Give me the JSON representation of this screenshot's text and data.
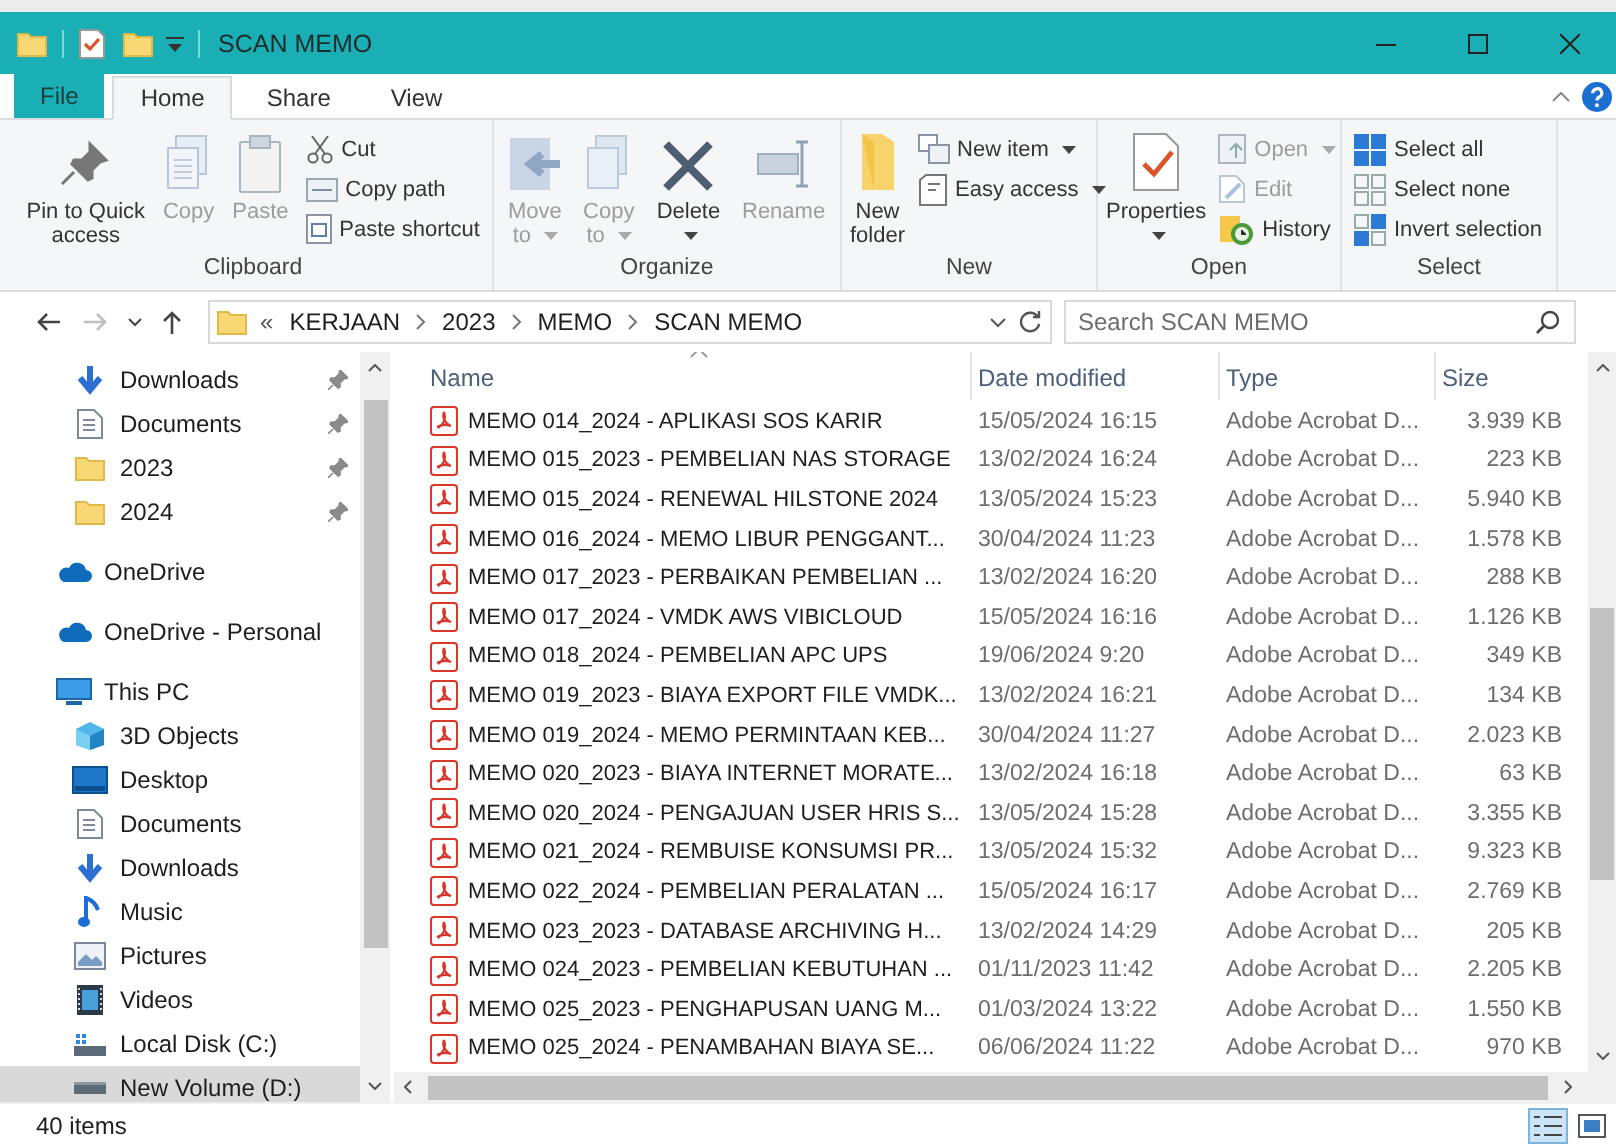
{
  "window": {
    "title": "SCAN MEMO"
  },
  "ribbon_tabs": [
    {
      "label": "File",
      "kind": "file",
      "selected": false
    },
    {
      "label": "Home",
      "kind": "tab",
      "selected": true
    },
    {
      "label": "Share",
      "kind": "tab",
      "selected": false
    },
    {
      "label": "View",
      "kind": "tab",
      "selected": false
    }
  ],
  "ribbon_groups": [
    {
      "label": "Clipboard",
      "commands": [
        {
          "label": "Pin to Quick access",
          "kind": "large",
          "disabled": false,
          "dropdown": false
        },
        {
          "label": "Copy",
          "kind": "large",
          "disabled": true,
          "dropdown": false
        },
        {
          "label": "Paste",
          "kind": "large",
          "disabled": true,
          "dropdown": false
        },
        {
          "label": "Cut",
          "kind": "small",
          "disabled": false,
          "dropdown": false
        },
        {
          "label": "Copy path",
          "kind": "small",
          "disabled": false,
          "dropdown": false
        },
        {
          "label": "Paste shortcut",
          "kind": "small",
          "disabled": false,
          "dropdown": false
        }
      ]
    },
    {
      "label": "Organize",
      "commands": [
        {
          "label": "Move to",
          "kind": "large",
          "disabled": true,
          "dropdown": true
        },
        {
          "label": "Copy to",
          "kind": "large",
          "disabled": true,
          "dropdown": true
        },
        {
          "label": "Delete",
          "kind": "large",
          "disabled": false,
          "dropdown": true
        },
        {
          "label": "Rename",
          "kind": "large",
          "disabled": true,
          "dropdown": false
        }
      ]
    },
    {
      "label": "New",
      "commands": [
        {
          "label": "New folder",
          "kind": "large",
          "disabled": false,
          "dropdown": false
        },
        {
          "label": "New item",
          "kind": "small",
          "disabled": false,
          "dropdown": true
        },
        {
          "label": "Easy access",
          "kind": "small",
          "disabled": false,
          "dropdown": true
        }
      ]
    },
    {
      "label": "Open",
      "commands": [
        {
          "label": "Properties",
          "kind": "large",
          "disabled": false,
          "dropdown": true
        },
        {
          "label": "Open",
          "kind": "small",
          "disabled": true,
          "dropdown": true
        },
        {
          "label": "Edit",
          "kind": "small",
          "disabled": true,
          "dropdown": false
        },
        {
          "label": "History",
          "kind": "small",
          "disabled": false,
          "dropdown": false
        }
      ]
    },
    {
      "label": "Select",
      "commands": [
        {
          "label": "Select all",
          "kind": "small",
          "disabled": false,
          "dropdown": false
        },
        {
          "label": "Select none",
          "kind": "small",
          "disabled": false,
          "dropdown": false
        },
        {
          "label": "Invert selection",
          "kind": "small",
          "disabled": false,
          "dropdown": false
        }
      ]
    }
  ],
  "address_bar": {
    "nav_buttons": [
      {
        "disabled": false
      },
      {
        "disabled": true
      },
      {
        "disabled": false
      },
      {
        "disabled": false
      }
    ],
    "overflow": "«",
    "path": [
      "KERJAAN",
      "2023",
      "MEMO",
      "SCAN MEMO"
    ],
    "search": {
      "placeholder": "Search SCAN MEMO"
    }
  },
  "nav_pane": {
    "quick_access": [
      {
        "label": "Downloads",
        "pinned": true
      },
      {
        "label": "Documents",
        "pinned": true
      },
      {
        "label": "2023",
        "pinned": true
      },
      {
        "label": "2024",
        "pinned": true
      }
    ],
    "locations": [
      {
        "label": "OneDrive",
        "selected": false
      },
      {
        "label": "OneDrive - Personal",
        "selected": false
      }
    ],
    "this_pc": {
      "label": "This PC",
      "selected": false,
      "children": [
        {
          "label": "3D Objects",
          "selected": false
        },
        {
          "label": "Desktop",
          "selected": false
        },
        {
          "label": "Documents",
          "selected": false
        },
        {
          "label": "Downloads",
          "selected": false
        },
        {
          "label": "Music",
          "selected": false
        },
        {
          "label": "Pictures",
          "selected": false
        },
        {
          "label": "Videos",
          "selected": false
        },
        {
          "label": "Local Disk (C:)",
          "selected": false
        },
        {
          "label": "New Volume (D:)",
          "selected": true
        }
      ]
    }
  },
  "file_list": {
    "columns": [
      {
        "label": "Name",
        "sorted": true
      },
      {
        "label": "Date modified",
        "sorted": false
      },
      {
        "label": "Type",
        "sorted": false
      },
      {
        "label": "Size",
        "sorted": false
      }
    ],
    "rows": [
      {
        "name": "MEMO 014_2024 - APLIKASI SOS KARIR",
        "date": "15/05/2024 16:15",
        "type": "Adobe Acrobat D...",
        "size": "3.939 KB"
      },
      {
        "name": "MEMO 015_2023 - PEMBELIAN NAS STORAGE",
        "date": "13/02/2024 16:24",
        "type": "Adobe Acrobat D...",
        "size": "223 KB"
      },
      {
        "name": "MEMO 015_2024 - RENEWAL HILSTONE 2024",
        "date": "13/05/2024 15:23",
        "type": "Adobe Acrobat D...",
        "size": "5.940 KB"
      },
      {
        "name": "MEMO 016_2024 - MEMO LIBUR PENGGANT...",
        "date": "30/04/2024 11:23",
        "type": "Adobe Acrobat D...",
        "size": "1.578 KB"
      },
      {
        "name": "MEMO 017_2023 - PERBAIKAN PEMBELIAN ...",
        "date": "13/02/2024 16:20",
        "type": "Adobe Acrobat D...",
        "size": "288 KB"
      },
      {
        "name": "MEMO 017_2024 - VMDK AWS VIBICLOUD",
        "date": "15/05/2024 16:16",
        "type": "Adobe Acrobat D...",
        "size": "1.126 KB"
      },
      {
        "name": "MEMO 018_2024 - PEMBELIAN APC UPS",
        "date": "19/06/2024 9:20",
        "type": "Adobe Acrobat D...",
        "size": "349 KB"
      },
      {
        "name": "MEMO 019_2023 - BIAYA EXPORT FILE VMDK...",
        "date": "13/02/2024 16:21",
        "type": "Adobe Acrobat D...",
        "size": "134 KB"
      },
      {
        "name": "MEMO 019_2024 - MEMO PERMINTAAN KEB...",
        "date": "30/04/2024 11:27",
        "type": "Adobe Acrobat D...",
        "size": "2.023 KB"
      },
      {
        "name": "MEMO 020_2023 - BIAYA INTERNET MORATE...",
        "date": "13/02/2024 16:18",
        "type": "Adobe Acrobat D...",
        "size": "63 KB"
      },
      {
        "name": "MEMO 020_2024 - PENGAJUAN USER HRIS S...",
        "date": "13/05/2024 15:28",
        "type": "Adobe Acrobat D...",
        "size": "3.355 KB"
      },
      {
        "name": "MEMO 021_2024 - REMBUISE KONSUMSI PR...",
        "date": "13/05/2024 15:32",
        "type": "Adobe Acrobat D...",
        "size": "9.323 KB"
      },
      {
        "name": "MEMO 022_2024 - PEMBELIAN PERALATAN ...",
        "date": "15/05/2024 16:17",
        "type": "Adobe Acrobat D...",
        "size": "2.769 KB"
      },
      {
        "name": "MEMO 023_2023 - DATABASE ARCHIVING H...",
        "date": "13/02/2024 14:29",
        "type": "Adobe Acrobat D...",
        "size": "205 KB"
      },
      {
        "name": "MEMO 024_2023 - PEMBELIAN KEBUTUHAN ...",
        "date": "01/11/2023 11:42",
        "type": "Adobe Acrobat D...",
        "size": "2.205 KB"
      },
      {
        "name": "MEMO 025_2023 - PENGHAPUSAN UANG M...",
        "date": "01/03/2024 13:22",
        "type": "Adobe Acrobat D...",
        "size": "1.550 KB"
      },
      {
        "name": "MEMO 025_2024 - PENAMBAHAN BIAYA SE...",
        "date": "06/06/2024 11:22",
        "type": "Adobe Acrobat D...",
        "size": "970 KB"
      }
    ]
  },
  "status_bar": {
    "item_count": "40 items",
    "views": [
      {
        "selected": true
      },
      {
        "selected": false
      }
    ]
  }
}
